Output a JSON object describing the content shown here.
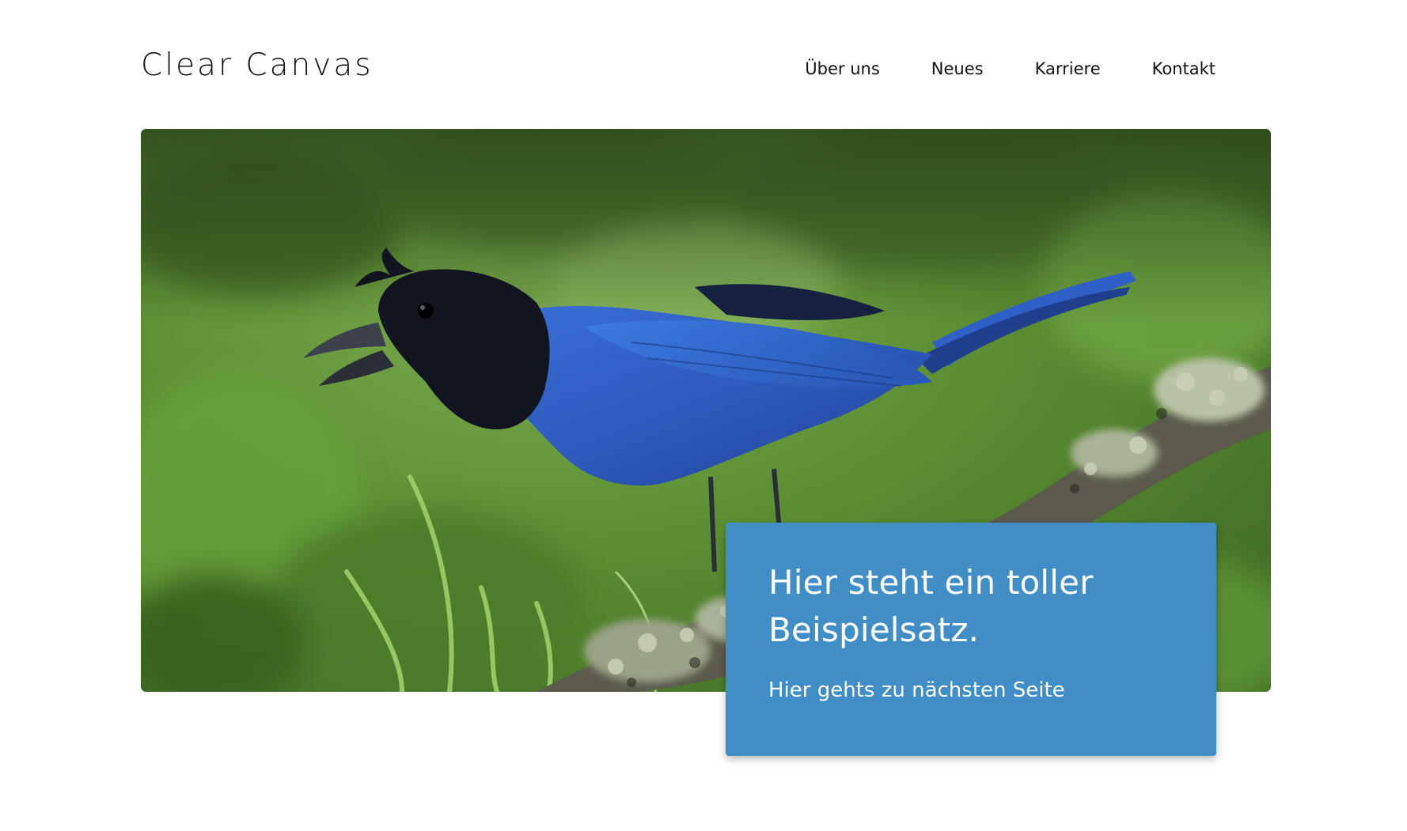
{
  "header": {
    "logo_text": "Clear Canvas",
    "nav": [
      {
        "label": "Über uns"
      },
      {
        "label": "Neues"
      },
      {
        "label": "Karriere"
      },
      {
        "label": "Kontakt"
      }
    ]
  },
  "hero": {
    "image_subject": "blue jay perched on a lichen-covered branch"
  },
  "callout": {
    "headline": "Hier steht ein toller Beispielsatz.",
    "link_text": "Hier gehts zu nächsten Seite"
  },
  "colors": {
    "accent": "#418dc5",
    "text": "#111111",
    "background": "#ffffff",
    "bird_blue": "#2f5fc4",
    "foliage_green": "#5f9a35"
  },
  "icons": {
    "hero_image": "bird-photo"
  }
}
